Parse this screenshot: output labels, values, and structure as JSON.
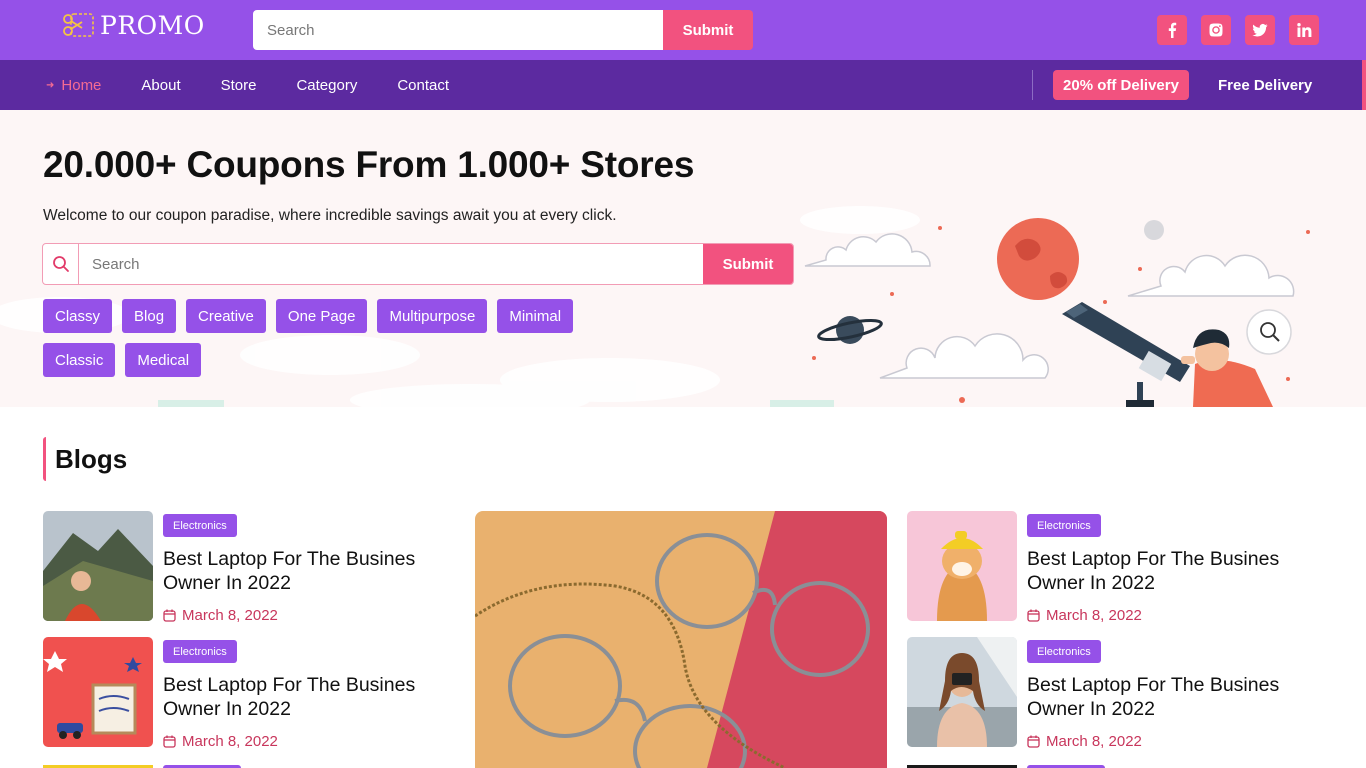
{
  "brand": {
    "logo_text": "PROMO"
  },
  "header": {
    "search": {
      "placeholder": "Search",
      "button_label": "Submit"
    },
    "socials": [
      "facebook-icon",
      "instagram-icon",
      "twitter-icon",
      "linkedin-icon"
    ]
  },
  "nav": {
    "items": [
      {
        "label": "Home",
        "active": true
      },
      {
        "label": "About"
      },
      {
        "label": "Store"
      },
      {
        "label": "Category"
      },
      {
        "label": "Contact"
      }
    ],
    "promo_badge": "20% off Delivery",
    "free_delivery": "Free Delivery"
  },
  "hero": {
    "title": "20.000+ Coupons From 1.000+ Stores",
    "subtitle": "Welcome to our coupon paradise, where incredible savings await you at every click.",
    "search": {
      "placeholder": "Search",
      "button_label": "Submit"
    },
    "tags": [
      "Classy",
      "Blog",
      "Creative",
      "One Page",
      "Multipurpose",
      "Minimal",
      "Classic",
      "Medical"
    ]
  },
  "blogs": {
    "heading": "Blogs",
    "posts": [
      {
        "category": "Electronics",
        "title": "Best Laptop For The Busines Owner In 2022",
        "date": "March 8, 2022"
      },
      {
        "category": "Electronics",
        "title": "Best Laptop For The Busines Owner In 2022",
        "date": "March 8, 2022"
      },
      {
        "category": "Electronics",
        "title": "Best Laptop For The Busines Owner In 2022",
        "date": "March 8, 2022"
      },
      {
        "category": "Electronics",
        "title": "Best Laptop For The Busines Owner In 2022",
        "date": "March 8, 2022"
      }
    ]
  },
  "colors": {
    "primary": "#9551e8",
    "nav": "#5c2aa0",
    "accent": "#f2527f",
    "hero_bg": "#fdf6f6"
  }
}
